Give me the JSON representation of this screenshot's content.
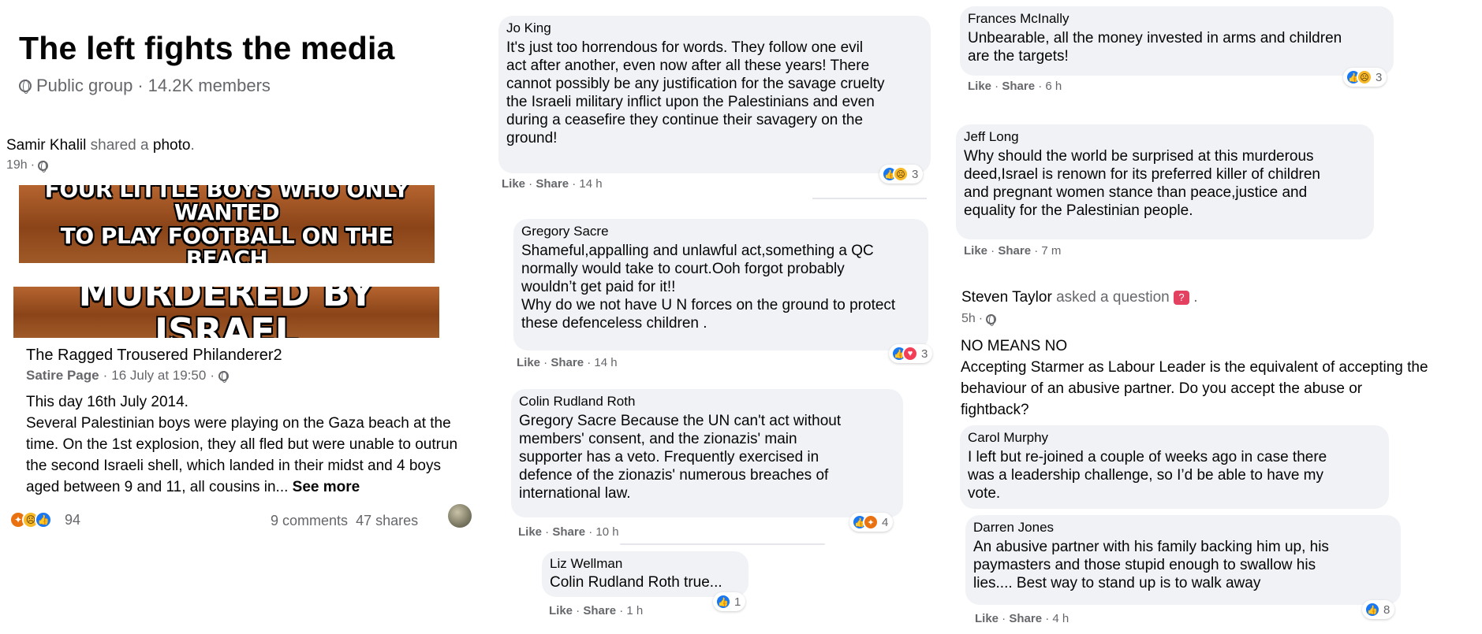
{
  "group": {
    "title": "The left fights the media",
    "privacy": "Public group",
    "members": "14.2K members"
  },
  "share": {
    "author": "Samir Khalil",
    "verb": "shared a",
    "object": "photo",
    "time": "19h"
  },
  "banner1": {
    "line1": "FOUR LITTLE BOYS WHO ONLY WANTED",
    "line2": "TO PLAY FOOTBALL ON THE BEACH"
  },
  "banner2": {
    "text": "MURDERED BY ISRAEL"
  },
  "page_post": {
    "page_name": "The Ragged Trousered Philanderer2",
    "page_type": "Satire Page",
    "date": "16 July at 19:50",
    "line1": "This day 16th July 2014.",
    "line2": "Several Palestinian boys were playing on the Gaza beach at the",
    "line3": "time. On the 1st explosion, they all fled but were unable to outrun",
    "line4": "the second Israeli shell, which landed in their midst and 4 boys",
    "line5": "aged between 9 and 11, all cousins in...",
    "see_more": "See more"
  },
  "post_stats": {
    "reaction_count": "94",
    "comments": "9 comments",
    "shares": "47 shares"
  },
  "action_labels": {
    "like": "Like",
    "share": "Share"
  },
  "comments_mid": [
    {
      "name": "Jo King",
      "lines": [
        "It's just too horrendous for words. They follow one evil",
        "act after another, even now after all these years! There",
        "cannot possibly be any justification for the savage cruelty",
        "the Israeli military inflict upon the Palestinians and even",
        "during a ceasefire they continue their savagery on the",
        "ground!"
      ],
      "time": "14 h",
      "reactions": "3"
    },
    {
      "name": "Gregory Sacre",
      "lines": [
        "Shameful,appalling and unlawful act,something a QC",
        "normally would take to court.Ooh forgot probably",
        "wouldn’t get paid for it!!",
        "Why do we not have U N forces on the ground to protect",
        "these defenceless children ."
      ],
      "time": "14 h",
      "reactions": "3"
    },
    {
      "name": "Colin Rudland Roth",
      "tag": "Gregory Sacre",
      "line1_rest": " Because the UN can't act without",
      "lines": [
        "members' consent, and the zionazis' main",
        "supporter has a veto. Frequently exercised in",
        "defence of the zionazis' numerous breaches of",
        "international law."
      ],
      "time": "10 h",
      "reactions": "4"
    },
    {
      "name": "Liz Wellman",
      "tag": "Colin Rudland Roth",
      "text": " true...",
      "time": "1 h",
      "reactions": "1"
    }
  ],
  "comments_right": [
    {
      "name": "Frances McInally",
      "lines": [
        "Unbearable, all the money invested in arms and children",
        "are the targets!"
      ],
      "time": "6 h",
      "reactions": "3"
    },
    {
      "name": "Jeff Long",
      "lines": [
        "Why should the world be surprised at this murderous",
        "deed,Israel is renown for its preferred killer of children",
        "and pregnant women stance than peace,justice and",
        "equality for the Palestinian people."
      ],
      "time": "7 m"
    }
  ],
  "question_post": {
    "author": "Steven Taylor",
    "verb": "asked a question",
    "time": "5h",
    "lines": [
      "NO MEANS NO",
      "Accepting Starmer as Labour Leader is the equivalent of accepting the",
      "behaviour of an abusive partner. Do you accept the abuse or",
      "fightback?"
    ]
  },
  "comments_q": [
    {
      "name": "Carol Murphy",
      "lines": [
        "I left but re-joined a couple of weeks ago in case there",
        "was a leadership challenge, so I’d be able to have my",
        "vote."
      ]
    },
    {
      "name": "Darren Jones",
      "lines": [
        "An abusive partner with his family backing him up, his",
        "paymasters and those stupid enough to swallow his",
        "lies.... Best way to stand up is to walk away"
      ],
      "time": "4 h",
      "reactions": "8"
    }
  ],
  "colors": {
    "like": "#1877f2",
    "bubble": "#f0f2f5",
    "secondary_text": "#65676b",
    "banner": "#8a4418"
  },
  "icons": [
    "globe-icon",
    "like-reaction-icon",
    "sad-reaction-icon",
    "angry-reaction-icon",
    "love-reaction-icon",
    "question-icon"
  ]
}
